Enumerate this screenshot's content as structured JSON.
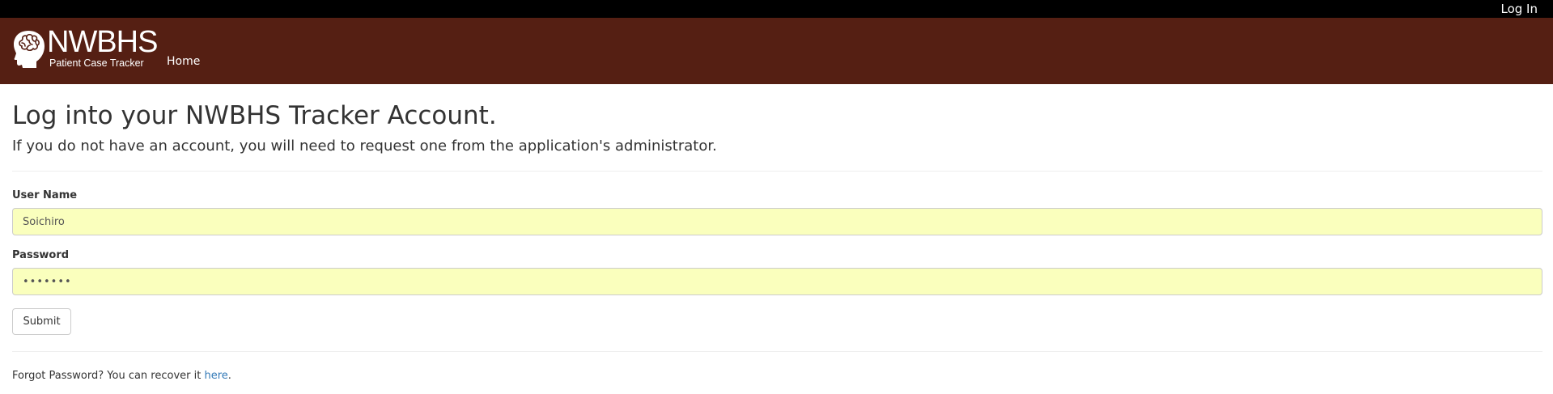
{
  "topbar": {
    "login_label": "Log In"
  },
  "navbar": {
    "brand_title": "NWBHS",
    "brand_subtitle": "Patient Case Tracker",
    "brand_icon": "brain-head-icon",
    "home_label": "Home"
  },
  "main": {
    "title": "Log into your NWBHS Tracker Account.",
    "subtitle": "If you do not have an account, you will need to request one from the application's administrator.",
    "form": {
      "username_label": "User Name",
      "username_value": "Soichiro",
      "password_label": "Password",
      "password_value": "•••••••",
      "submit_label": "Submit"
    },
    "forgot": {
      "text": "Forgot Password? You can recover it ",
      "link_label": "here",
      "trailing": "."
    }
  },
  "colors": {
    "topbar_bg": "#000000",
    "navbar_bg": "#551f13",
    "autofill_bg": "#faffbd",
    "link": "#337ab7"
  }
}
